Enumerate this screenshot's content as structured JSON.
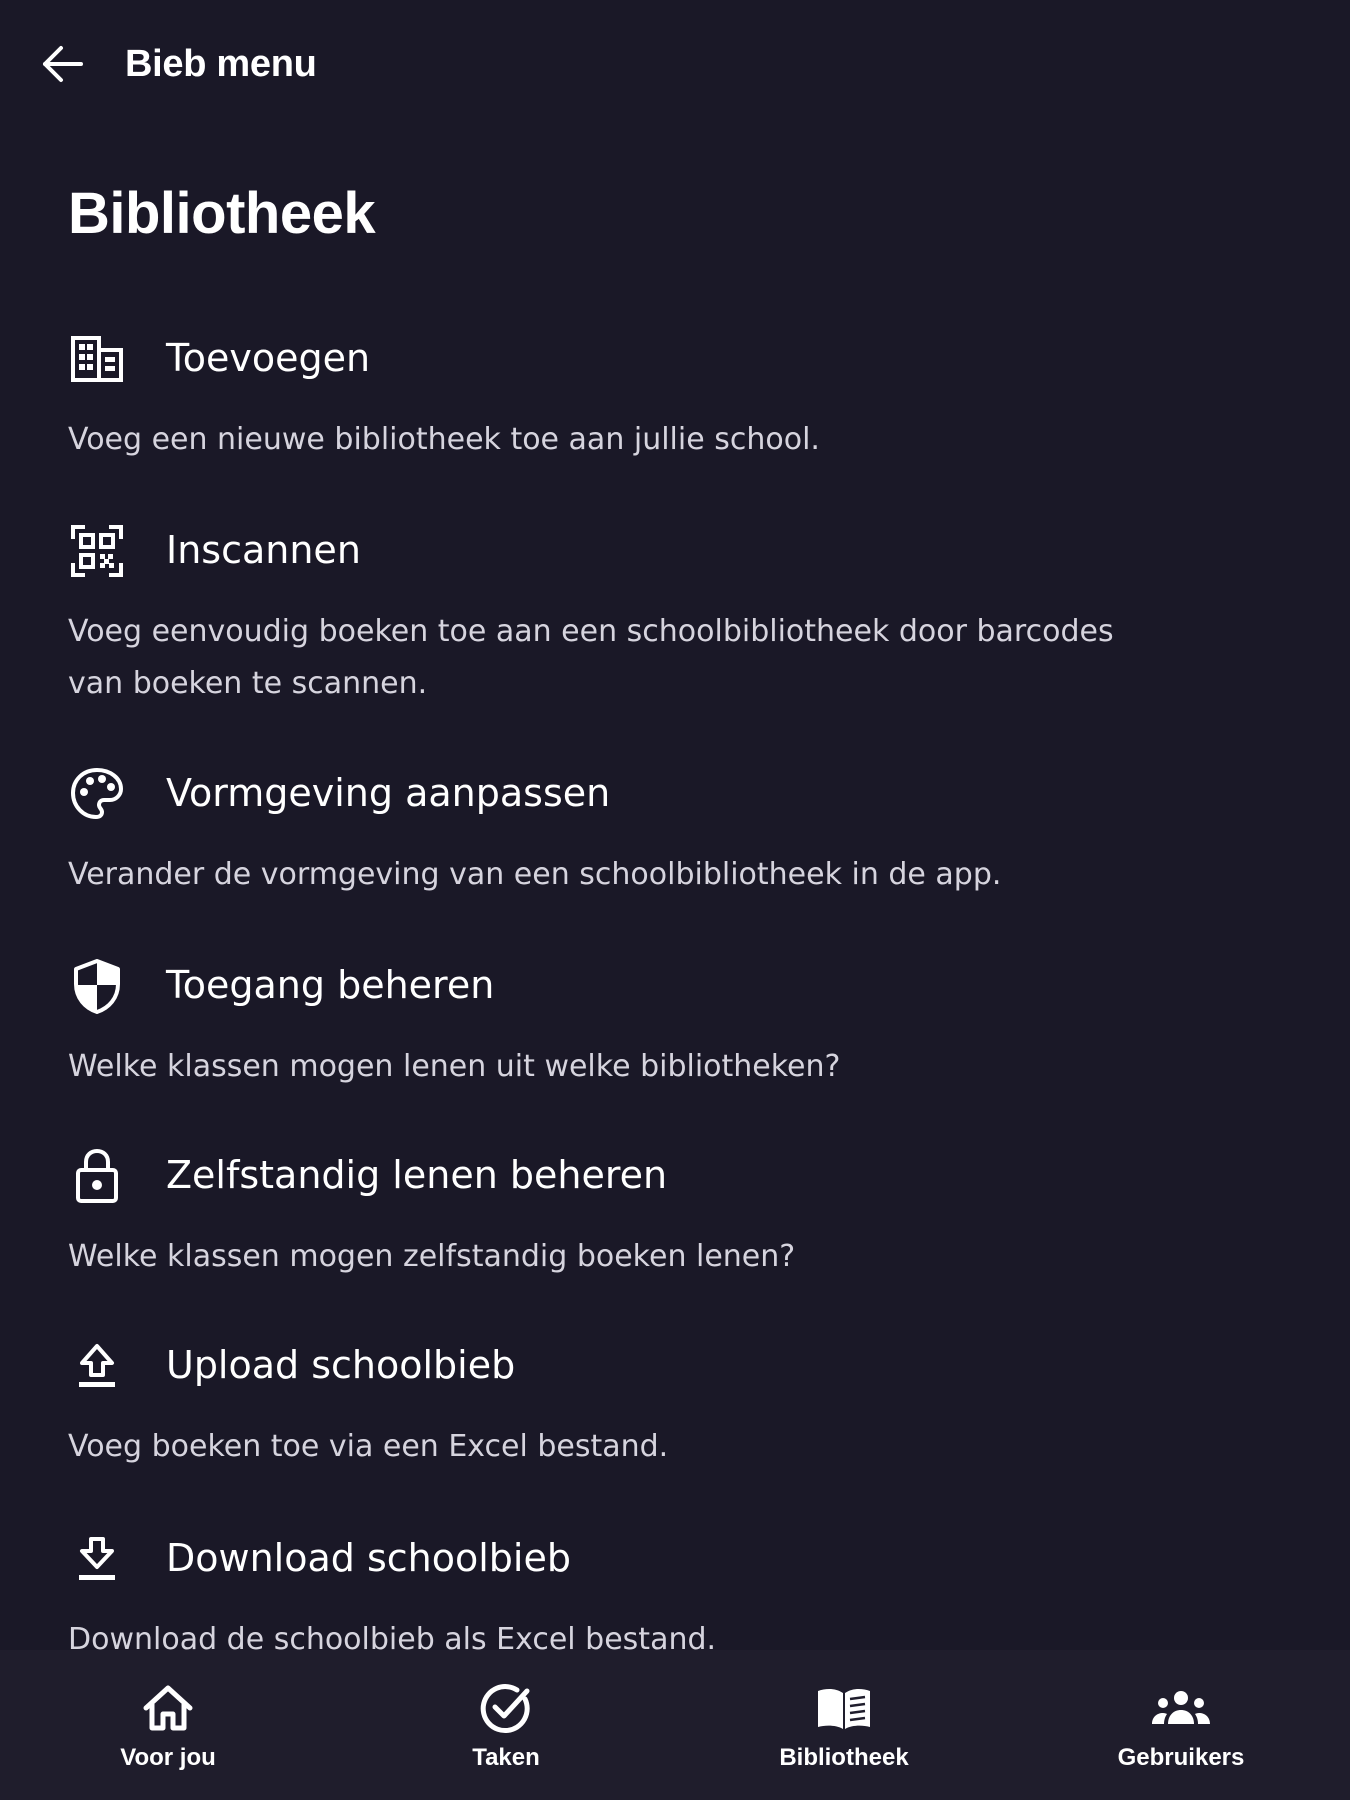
{
  "topbar": {
    "title": "Bieb menu",
    "back_icon": "arrow-left-icon"
  },
  "page": {
    "title": "Bibliotheek"
  },
  "menu": {
    "items": [
      {
        "icon": "library-add-icon",
        "title": "Toevoegen",
        "description": "Voeg een nieuwe bibliotheek toe aan jullie school."
      },
      {
        "icon": "qr-scan-icon",
        "title": "Inscannen",
        "description": "Voeg eenvoudig boeken toe aan een schoolbibliotheek door barcodes van boeken te scannen."
      },
      {
        "icon": "palette-icon",
        "title": "Vormgeving aanpassen",
        "description": "Verander de vormgeving van een schoolbibliotheek in de app."
      },
      {
        "icon": "shield-icon",
        "title": "Toegang beheren",
        "description": "Welke klassen mogen lenen uit welke bibliotheken?"
      },
      {
        "icon": "lock-icon",
        "title": "Zelfstandig lenen beheren",
        "description": "Welke klassen mogen zelfstandig boeken lenen?"
      },
      {
        "icon": "upload-icon",
        "title": "Upload schoolbieb",
        "description": "Voeg boeken toe via een Excel bestand."
      },
      {
        "icon": "download-icon",
        "title": "Download schoolbieb",
        "description": "Download de schoolbieb als Excel bestand."
      }
    ]
  },
  "bottom_nav": {
    "items": [
      {
        "icon": "home-icon",
        "label": "Voor jou"
      },
      {
        "icon": "check-circle-icon",
        "label": "Taken"
      },
      {
        "icon": "book-open-icon",
        "label": "Bibliotheek"
      },
      {
        "icon": "users-icon",
        "label": "Gebruikers"
      }
    ]
  },
  "colors": {
    "background": "#1a1827",
    "nav_background": "#1f1d2c",
    "text": "#ffffff",
    "muted_text": "#d6d4de"
  }
}
